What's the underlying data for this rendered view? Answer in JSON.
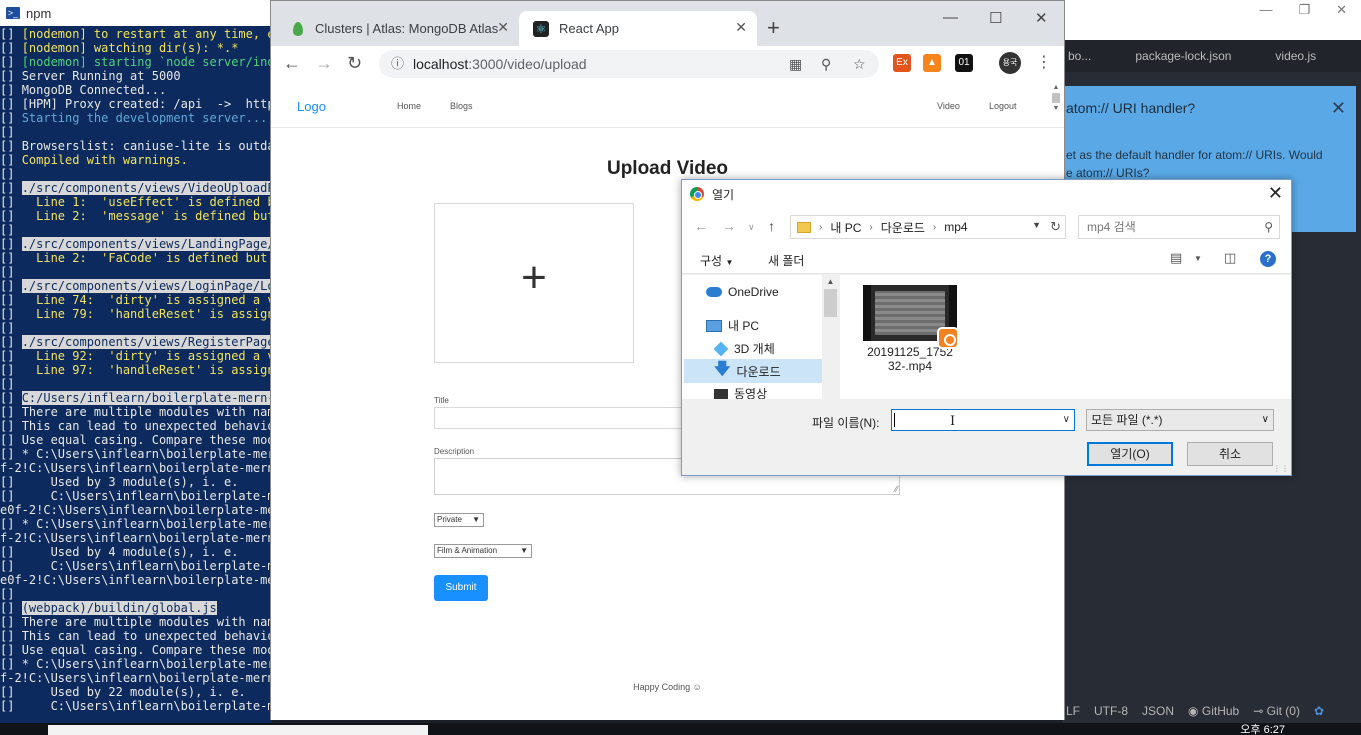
{
  "terminal": {
    "title": "npm",
    "lines": [
      {
        "prefix": "[] ",
        "text": "[nodemon] to restart at any time, enter `rs`",
        "color": "yellow"
      },
      {
        "prefix": "[] ",
        "text": "[nodemon] watching dir(s): *.*",
        "color": "yellow"
      },
      {
        "prefix": "[] ",
        "text": "[nodemon] starting `node server/index.js`",
        "color": "green"
      },
      {
        "prefix": "[] ",
        "text": "Server Running at 5000",
        "color": "white"
      },
      {
        "prefix": "[] ",
        "text": "MongoDB Connected...",
        "color": "white"
      },
      {
        "prefix": "[] ",
        "text": "[HPM] Proxy created: /api  ->  http",
        "color": "white"
      },
      {
        "prefix": "[] ",
        "text": "Starting the development server...",
        "color": "cyan"
      },
      {
        "prefix": "[] ",
        "text": "",
        "color": "white"
      },
      {
        "prefix": "[] ",
        "text": "Browserslist: caniuse-lite is outdated",
        "color": "white"
      },
      {
        "prefix": "[] ",
        "text": "Compiled with warnings.",
        "color": "yellow"
      },
      {
        "prefix": "[] ",
        "text": "",
        "color": "white"
      },
      {
        "prefix": "[] ",
        "text": "./src/components/views/VideoUploadPage",
        "color": "hl"
      },
      {
        "prefix": "[] ",
        "text": "  Line 1:  'useEffect' is defined but",
        "color": "yellow"
      },
      {
        "prefix": "[] ",
        "text": "  Line 2:  'message' is defined but",
        "color": "yellow"
      },
      {
        "prefix": "[] ",
        "text": "",
        "color": "white"
      },
      {
        "prefix": "[] ",
        "text": "./src/components/views/LandingPage/",
        "color": "hl"
      },
      {
        "prefix": "[] ",
        "text": "  Line 2:  'FaCode' is defined but",
        "color": "yellow"
      },
      {
        "prefix": "[] ",
        "text": "",
        "color": "white"
      },
      {
        "prefix": "[] ",
        "text": "./src/components/views/LoginPage/Lo",
        "color": "hl"
      },
      {
        "prefix": "[] ",
        "text": "  Line 74:  'dirty' is assigned a v",
        "color": "yellow"
      },
      {
        "prefix": "[] ",
        "text": "  Line 79:  'handleReset' is assign",
        "color": "yellow"
      },
      {
        "prefix": "[] ",
        "text": "",
        "color": "white"
      },
      {
        "prefix": "[] ",
        "text": "./src/components/views/RegisterPage",
        "color": "hl"
      },
      {
        "prefix": "[] ",
        "text": "  Line 92:  'dirty' is assigned a v",
        "color": "yellow"
      },
      {
        "prefix": "[] ",
        "text": "  Line 97:  'handleReset' is assign",
        "color": "yellow"
      },
      {
        "prefix": "[] ",
        "text": "",
        "color": "white"
      },
      {
        "prefix": "[] ",
        "text": "C:/Users/inflearn/boilerplate-mern-",
        "color": "hl"
      },
      {
        "prefix": "[] ",
        "text": "There are multiple modules with nam",
        "color": "white"
      },
      {
        "prefix": "[] ",
        "text": "This can lead to unexpected behavio",
        "color": "white"
      },
      {
        "prefix": "[] ",
        "text": "Use equal casing. Compare these mod",
        "color": "white"
      },
      {
        "prefix": "[] ",
        "text": "* C:\\Users\\inflearn\\boilerplate-mer",
        "color": "white"
      },
      {
        "prefix": "",
        "text": "f-2!C:\\Users\\inflearn\\boilerplate-mern-",
        "color": "white"
      },
      {
        "prefix": "[] ",
        "text": "    Used by 3 module(s), i. e.",
        "color": "white"
      },
      {
        "prefix": "[] ",
        "text": "    C:\\Users\\inflearn\\boilerplate-m",
        "color": "white"
      },
      {
        "prefix": "",
        "text": "e0f-2!C:\\Users\\inflearn\\boilerplate-mern",
        "color": "white"
      },
      {
        "prefix": "[] ",
        "text": "* C:\\Users\\inflearn\\boilerplate-mer",
        "color": "white"
      },
      {
        "prefix": "",
        "text": "f-2!C:\\Users\\inflearn\\boilerplate-mern-",
        "color": "white"
      },
      {
        "prefix": "[] ",
        "text": "    Used by 4 module(s), i. e.",
        "color": "white"
      },
      {
        "prefix": "[] ",
        "text": "    C:\\Users\\inflearn\\boilerplate-m",
        "color": "white"
      },
      {
        "prefix": "",
        "text": "e0f-2!C:\\Users\\inflearn\\boilerplate-mern",
        "color": "white"
      },
      {
        "prefix": "[] ",
        "text": "",
        "color": "white"
      },
      {
        "prefix": "[] ",
        "text": "(webpack)/buildin/global.js",
        "color": "hl"
      },
      {
        "prefix": "[] ",
        "text": "There are multiple modules with nam",
        "color": "white"
      },
      {
        "prefix": "[] ",
        "text": "This can lead to unexpected behavio",
        "color": "white"
      },
      {
        "prefix": "[] ",
        "text": "Use equal casing. Compare these mod",
        "color": "white"
      },
      {
        "prefix": "[] ",
        "text": "* C:\\Users\\inflearn\\boilerplate-mer",
        "color": "white"
      },
      {
        "prefix": "",
        "text": "f-2!C:\\Users\\inflearn\\boilerplate-mern-",
        "color": "white"
      },
      {
        "prefix": "[] ",
        "text": "    Used by 22 module(s), i. e.",
        "color": "white"
      },
      {
        "prefix": "[] ",
        "text": "    C:\\Users\\inflearn\\boilerplate-m",
        "color": "white"
      }
    ]
  },
  "atom": {
    "tabs": [
      "bo...",
      "package-lock.json",
      "video.js"
    ],
    "notice": {
      "title": "atom:// URI handler?",
      "body_line1": "et as the default handler for atom:// URIs. Would",
      "body_line2": "e atom:// URIs?"
    },
    "status": {
      "lf": "LF",
      "encoding": "UTF-8",
      "grammar": "JSON",
      "github": "GitHub",
      "git": "Git (0)"
    }
  },
  "taskbar": {
    "clock": "오후 6:27"
  },
  "browser": {
    "tabs": [
      {
        "label": "Clusters | Atlas: MongoDB Atlas",
        "active": false
      },
      {
        "label": "React App",
        "active": true
      }
    ],
    "new_tab": "+",
    "url_host": "localhost",
    "url_rest": ":3000/video/upload",
    "profile_initials": "용국",
    "ext_labels": {
      "ex": "Ex",
      "counter": "01"
    }
  },
  "page": {
    "logo": "Logo",
    "nav_left": [
      "Home",
      "Blogs"
    ],
    "nav_right": [
      "Video",
      "Logout"
    ],
    "title": "Upload Video",
    "dropzone_symbol": "+",
    "title_label": "Title",
    "description_label": "Description",
    "privacy_select": "Private",
    "category_select": "Film & Animation",
    "submit_label": "Submit",
    "footer": "Happy Coding"
  },
  "dialog": {
    "title": "열기",
    "path": [
      "내 PC",
      "다운로드",
      "mp4"
    ],
    "search_placeholder": "mp4 검색",
    "organize": "구성",
    "new_folder": "새 폴더",
    "tree": [
      "OneDrive",
      "내 PC",
      "3D 개체",
      "다운로드",
      "동영상"
    ],
    "file": {
      "name_line1": "20191125_1752",
      "name_line2": "32-.mp4"
    },
    "filename_label": "파일 이름(N):",
    "filename_value": "",
    "filter": "모든 파일 (*.*)",
    "open_button": "열기(O)",
    "cancel_button": "취소"
  }
}
